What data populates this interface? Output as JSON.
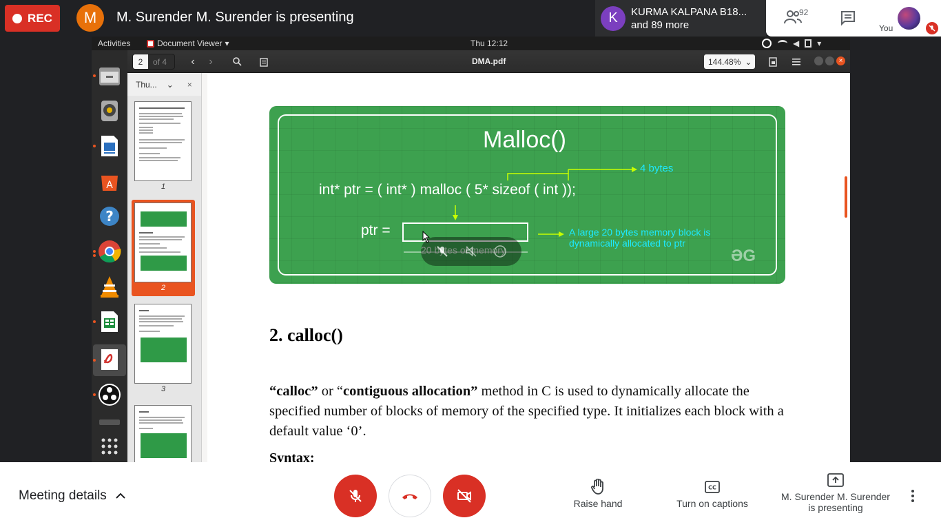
{
  "meet": {
    "rec_label": "REC",
    "presenter_initial": "M",
    "presenting_title": "M. Surender M. Surender is presenting",
    "speaker_initial": "K",
    "speaker_name": "KURMA KALPANA B18...",
    "speaker_more": "and 89 more",
    "participant_count": "92",
    "self_label": "You",
    "meeting_details_label": "Meeting details",
    "raise_hand_label": "Raise hand",
    "captions_label": "Turn on captions",
    "presenting_line1": "M. Surender M. Surender",
    "presenting_line2": "is presenting",
    "colors": {
      "red": "#d93025",
      "speaker_bg": "#2d2e30"
    }
  },
  "ubuntu": {
    "activities": "Activities",
    "app_name": "Document Viewer",
    "clock": "Thu 12:12",
    "dock_items": [
      "files-icon",
      "rhythmbox-icon",
      "writer-icon",
      "software-icon",
      "help-icon",
      "chrome-icon",
      "vlc-icon",
      "calc-icon",
      "document-viewer-icon",
      "obs-icon",
      "keyboard-icon",
      "apps-grid-icon"
    ]
  },
  "viewer": {
    "page_current": "2",
    "page_of": "of 4",
    "file_title": "DMA.pdf",
    "zoom": "144.48%",
    "sidebar_mode": "Thu...",
    "sidebar_close": "×",
    "thumbnails": [
      "1",
      "2",
      "3"
    ],
    "selected_page": "2"
  },
  "document": {
    "figure": {
      "title": "Malloc()",
      "code": "int* ptr = ( int* ) malloc ( 5* sizeof ( int ));",
      "bytes_note": "4 bytes",
      "ptr_label": "ptr =",
      "desc_line1": "A large 20 bytes memory block is",
      "desc_line2": "dynamically allocated to ptr",
      "memory_label": "20 bytes of memory",
      "logo": "ƏG"
    },
    "heading": "2. calloc()",
    "para_q1": "“calloc”",
    "para_or": " or “",
    "para_bold2": "contiguous allocation”",
    "para_rest": " method in C is used to dynamically allocate the specified number of blocks of memory of the specified type. It initializes each block with a default value ‘0’.",
    "syntax": "Syntax:"
  }
}
